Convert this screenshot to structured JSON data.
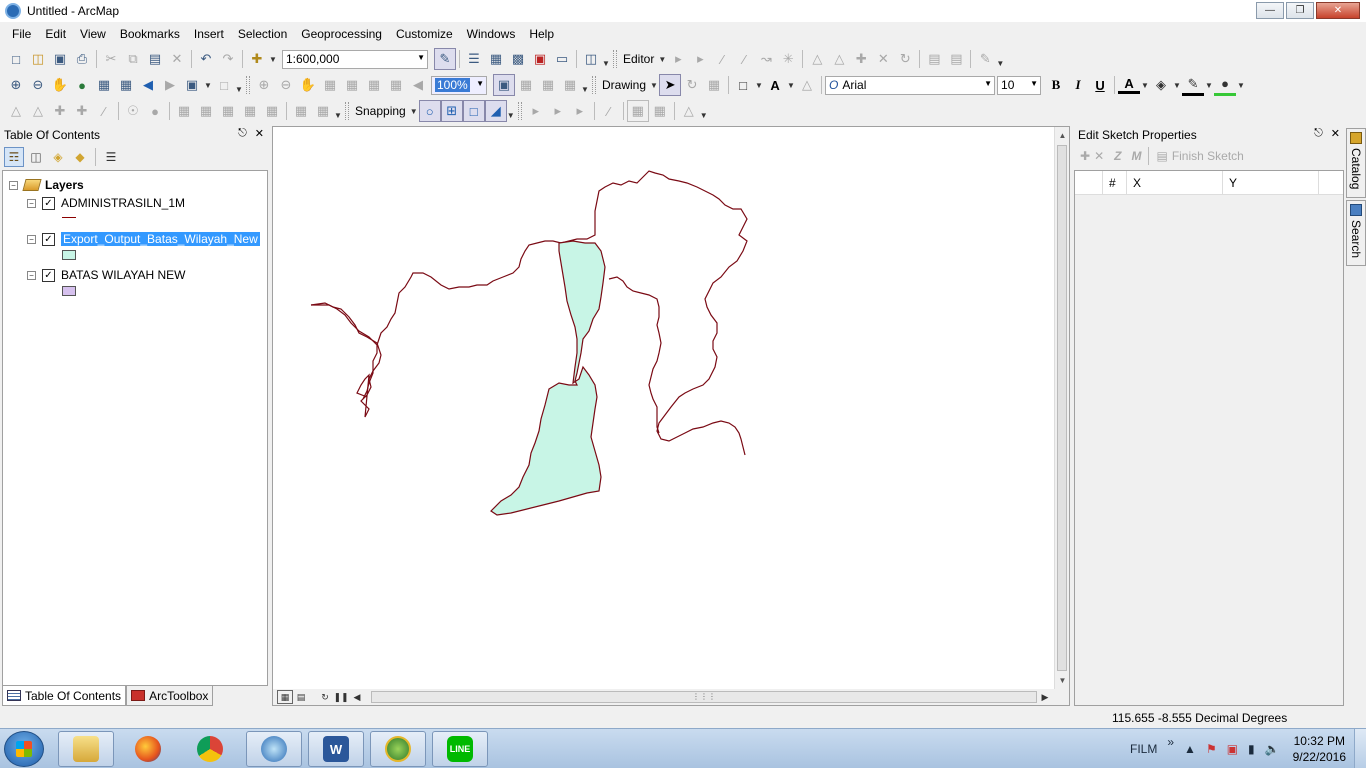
{
  "window": {
    "title": "Untitled - ArcMap",
    "min_glyph": "—",
    "max_glyph": "❐",
    "close_glyph": "✕"
  },
  "menu": [
    "File",
    "Edit",
    "View",
    "Bookmarks",
    "Insert",
    "Selection",
    "Geoprocessing",
    "Customize",
    "Windows",
    "Help"
  ],
  "toolbar1": {
    "scale": "1:600,000",
    "editor_label": "Editor"
  },
  "toolbar2": {
    "zoom_pct": "100%",
    "drawing_label": "Drawing",
    "font_name": "Arial",
    "font_size": "10",
    "bold": "B",
    "italic": "I",
    "underline": "U",
    "font_color_glyph": "A",
    "text_tool_glyph": "A"
  },
  "toolbar3": {
    "snapping_label": "Snapping"
  },
  "toc": {
    "title": "Table Of Contents",
    "root_label": "Layers",
    "layers": [
      {
        "name": "ADMINISTRASILN_1M",
        "checked": true,
        "selected": false,
        "symbol": "line",
        "color": "#8b0000"
      },
      {
        "name": "Export_Output_Batas_Wilayah_New",
        "checked": true,
        "selected": true,
        "symbol": "fill",
        "color": "#c8f5e6"
      },
      {
        "name": "BATAS WILAYAH NEW",
        "checked": true,
        "selected": false,
        "symbol": "fill",
        "color": "#d6c1ee"
      }
    ],
    "tabs": [
      "Table Of Contents",
      "ArcToolbox"
    ]
  },
  "map": {
    "outline_color": "#7a0a14",
    "fill_color": "#c8f5e6"
  },
  "sketch": {
    "title": "Edit Sketch Properties",
    "finish_label": "Finish Sketch",
    "z_label": "Z",
    "m_label": "M",
    "columns": [
      "#",
      "X",
      "Y"
    ]
  },
  "side_tabs": [
    "Catalog",
    "Search"
  ],
  "status": {
    "coordinates": "115.655  -8.555 Decimal Degrees"
  },
  "taskbar": {
    "apps": [
      "windows-explorer",
      "firefox",
      "chrome",
      "arcmap",
      "word",
      "arcgis-globe",
      "line"
    ],
    "word_glyph": "W",
    "line_label": "LINE",
    "tray_text": "FILM",
    "tray_chevron": "»",
    "time": "10:32 PM",
    "date": "9/22/2016"
  }
}
